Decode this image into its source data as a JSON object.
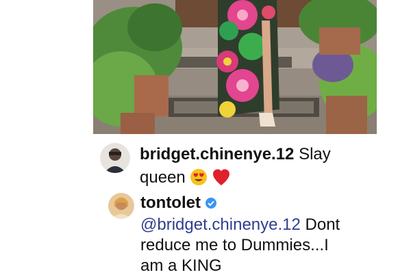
{
  "post": {
    "image_alt": "person in colorful print dress standing on tiled steps with potted plants"
  },
  "comments": [
    {
      "username": "bridget.chinenye.12",
      "text_line1": "Slay",
      "text_line2": "queen",
      "emojis": [
        "heart-eyes-emoji",
        "red-heart-emoji"
      ]
    },
    {
      "username": "tontolet",
      "verified": true,
      "mention": "@bridget.chinenye.12",
      "text_after_mention": "Dont",
      "text_line2": "reduce me to Dummies...I",
      "text_line3": "am a KING"
    }
  ],
  "colors": {
    "text": "#111111",
    "mention": "#2f3e8f",
    "verified_badge": "#3897f0",
    "heart": "#e0202a",
    "emoji_face": "#f7c21e"
  }
}
